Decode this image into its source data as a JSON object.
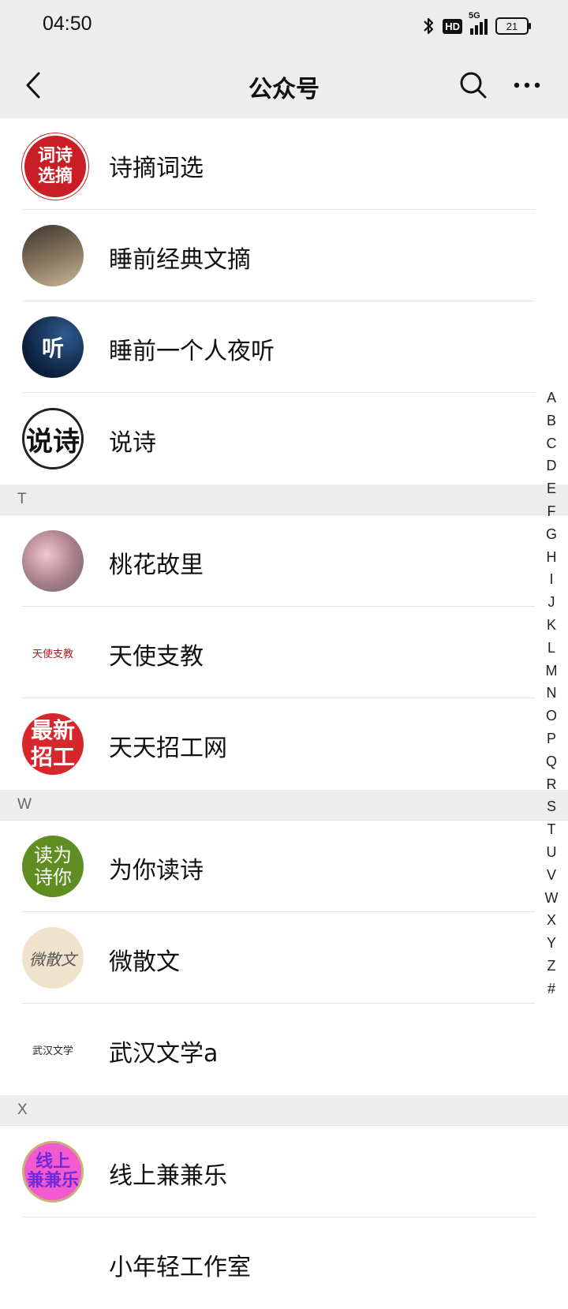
{
  "status": {
    "time": "04:50",
    "hd": "HD",
    "network": "5G",
    "battery": "21"
  },
  "nav": {
    "title": "公众号"
  },
  "rows": [
    {
      "type": "item",
      "name": "诗摘词选",
      "avatar_text": "词诗\n选摘",
      "style": "av-red"
    },
    {
      "type": "item",
      "name": "睡前经典文摘",
      "avatar_text": "",
      "style": "av-dark"
    },
    {
      "type": "item",
      "name": "睡前一个人夜听",
      "avatar_text": "听",
      "style": "av-night"
    },
    {
      "type": "item",
      "name": "说诗",
      "avatar_text": "说诗",
      "style": "av-white"
    },
    {
      "type": "section",
      "letter": "T"
    },
    {
      "type": "item",
      "name": "桃花故里",
      "avatar_text": "",
      "style": "av-peach"
    },
    {
      "type": "item",
      "name": "天使支教",
      "avatar_text": "天使支教",
      "style": "av-angel"
    },
    {
      "type": "item",
      "name": "天天招工网",
      "avatar_text": "最新\n招工",
      "style": "av-recruit"
    },
    {
      "type": "section",
      "letter": "W"
    },
    {
      "type": "item",
      "name": "为你读诗",
      "avatar_text": "读为\n诗你",
      "style": "av-green"
    },
    {
      "type": "item",
      "name": "微散文",
      "avatar_text": "微散文",
      "style": "av-beige"
    },
    {
      "type": "item",
      "name": "武汉文学a",
      "avatar_text": "武汉文学",
      "style": "av-wuhan"
    },
    {
      "type": "section",
      "letter": "X"
    },
    {
      "type": "item",
      "name": "线上兼兼乐",
      "avatar_text": "线上\n兼兼乐",
      "style": "av-pink"
    },
    {
      "type": "item",
      "name": "小年轻工作室",
      "avatar_text": "",
      "style": "av-sketch"
    }
  ],
  "index_letters": [
    "A",
    "B",
    "C",
    "D",
    "E",
    "F",
    "G",
    "H",
    "I",
    "J",
    "K",
    "L",
    "M",
    "N",
    "O",
    "P",
    "Q",
    "R",
    "S",
    "T",
    "U",
    "V",
    "W",
    "X",
    "Y",
    "Z",
    "#"
  ],
  "icons": {
    "back": "chevron-left-icon",
    "search": "search-icon",
    "more": "more-dots-icon",
    "bluetooth": "bluetooth-icon"
  }
}
